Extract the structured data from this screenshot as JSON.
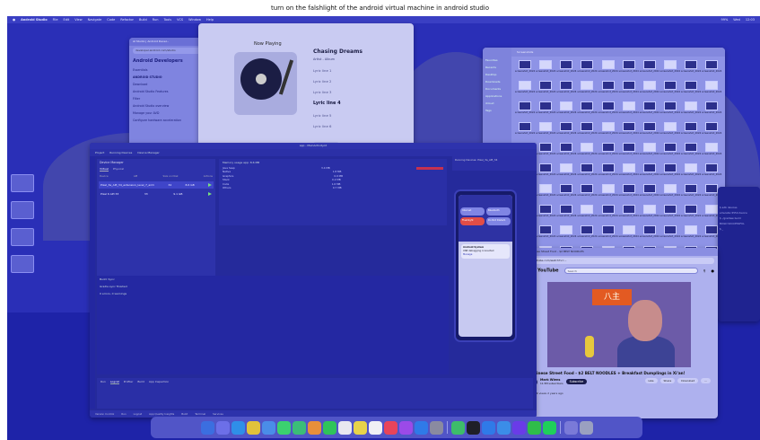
{
  "task_caption": "turn on the falshlight of the android virtual machine in android studio",
  "menubar": {
    "app": "Android Studio",
    "items": [
      "File",
      "Edit",
      "View",
      "Navigate",
      "Code",
      "Refactor",
      "Build",
      "Run",
      "Tools",
      "VCS",
      "Window",
      "Help"
    ],
    "right_items": [
      "99%",
      "Wed",
      "12:03"
    ]
  },
  "docs_window": {
    "tab_title": "AI Studio | Android Devel...",
    "address": "developer.android.com/studio",
    "brand": "Android Developers",
    "nav": "Essentials",
    "lines": [
      "ANDROID STUDIO",
      "Download",
      "Android Studio Features",
      "Filter",
      "Android Studio overview",
      "Manage your AVD",
      "Configure hardware acceleration"
    ]
  },
  "music_window": {
    "label": "Now Playing",
    "song_title": "Chasing Dreams",
    "meta": "Artist - Album",
    "lyrics": [
      "Lyric line 1",
      "Lyric line 2",
      "Lyric line 3",
      "Lyric line 4",
      "Lyric line 5",
      "Lyric line 6"
    ],
    "current_lyric_index": 3,
    "controls": "Play / Pause"
  },
  "finder_window": {
    "title": "Screenshots",
    "sidebar": [
      "Favorites",
      "Recents",
      "Desktop",
      "Downloads",
      "Documents",
      "Applications",
      "iCloud",
      "Tags"
    ],
    "file_prefix": "screenshot_2024",
    "rows": 10,
    "cols": 10
  },
  "youtube_window": {
    "tab_title": "Chinese Street Food - $2 BELT NOODLES",
    "address": "youtube.com/watch?v=...",
    "logo": "YouTube",
    "search_placeholder": "Search",
    "video_sign": "八主",
    "video_title": "Chinese Street Food - $2 BELT NOODLES + Breakfast Dumplings in Xi'an!",
    "channel": "Mark Wiens",
    "subscribers": "11.5M subscribers",
    "subscribe_label": "Subscribe",
    "actions": [
      "Like",
      "Share",
      "Download",
      "..."
    ],
    "views": "399K views  2 years ago"
  },
  "android_studio": {
    "title": "app - MainActivity.kt",
    "toolbar": [
      "Project",
      "Running Devices",
      "Device Manager"
    ],
    "device_manager": {
      "header": "Device Manager",
      "tabs": [
        "Virtual",
        "Physical"
      ],
      "columns": [
        "Device",
        "API",
        "Size on Disk",
        "Actions"
      ],
      "devices": [
        {
          "name": "Pixel_3a_API_34_extension_level_7_arm64",
          "api": "34",
          "size": "8.6 GB",
          "selected": true
        },
        {
          "name": "Pixel 6 API 33",
          "api": "33",
          "size": "9.1 GB",
          "selected": false
        }
      ]
    },
    "logcat": {
      "header": "Memory usage  app: 8.6 MB",
      "rows": [
        {
          "name": "Java heap",
          "value": "3.4 MB"
        },
        {
          "name": "Native",
          "value": "1.8 MB"
        },
        {
          "name": "Graphics",
          "value": "0.9 MB"
        },
        {
          "name": "Stack",
          "value": "0.2 MB"
        },
        {
          "name": "Code",
          "value": "1.6 MB"
        },
        {
          "name": "Others",
          "value": "0.7 MB"
        }
      ]
    },
    "bottom_header": "Build: Sync",
    "bottom_lines": [
      "Gradle sync finished",
      "0 errors, 0 warnings"
    ],
    "run_tabs": [
      "Run",
      "Logcat",
      "Profiler",
      "Build",
      "App Inspection"
    ],
    "run_active": "Logcat",
    "status": [
      "Version Control",
      "Run",
      "Logcat",
      "App Quality Insights",
      "Build",
      "Terminal",
      "Services"
    ]
  },
  "emulator": {
    "toolbar": "Running Devices: Pixel_3a_API_34",
    "tiles": [
      "Internet",
      "Bluetooth",
      "Flashlight",
      "Do Not Disturb"
    ],
    "hot_tile_index": 2,
    "notification": {
      "title": "Android System",
      "body": "USB debugging connected",
      "action": "Manage"
    }
  },
  "terminal": {
    "lines": [
      "$ adb devices",
      "emulator-5554 device",
      "$ ./gradlew build",
      "BUILD SUCCESSFUL",
      "$ _"
    ]
  },
  "dock": {
    "icons": [
      "finder-icon",
      "launchpad-icon",
      "safari-icon",
      "chrome-icon",
      "mail-icon",
      "messages-icon",
      "maps-icon",
      "photos-icon",
      "facetime-icon",
      "calendar-icon",
      "notes-icon",
      "reminders-icon",
      "music-icon",
      "podcasts-icon",
      "appstore-icon",
      "settings-icon",
      "android-studio-icon",
      "terminal-icon",
      "vscode-icon",
      "xcode-icon",
      "slack-icon",
      "wechat-icon",
      "spotify-icon",
      "downloads-icon",
      "trash-icon"
    ],
    "colors": [
      "#3b6ee0",
      "#6c6fe8",
      "#2f8fe8",
      "#e0c23b",
      "#4a8de8",
      "#3bd16f",
      "#3bbd78",
      "#e88f3b",
      "#2fc45a",
      "#e8e8f0",
      "#e8d34a",
      "#f0f0f5",
      "#e8445a",
      "#9b4ae8",
      "#2f7ae8",
      "#8a8aa0",
      "#3dbd6a",
      "#1f1f28",
      "#2f7ae8",
      "#3b8de8",
      "#6a3be8",
      "#2fbd4a",
      "#1fcf5a",
      "#7a7ad8",
      "#9aa0c0"
    ]
  }
}
